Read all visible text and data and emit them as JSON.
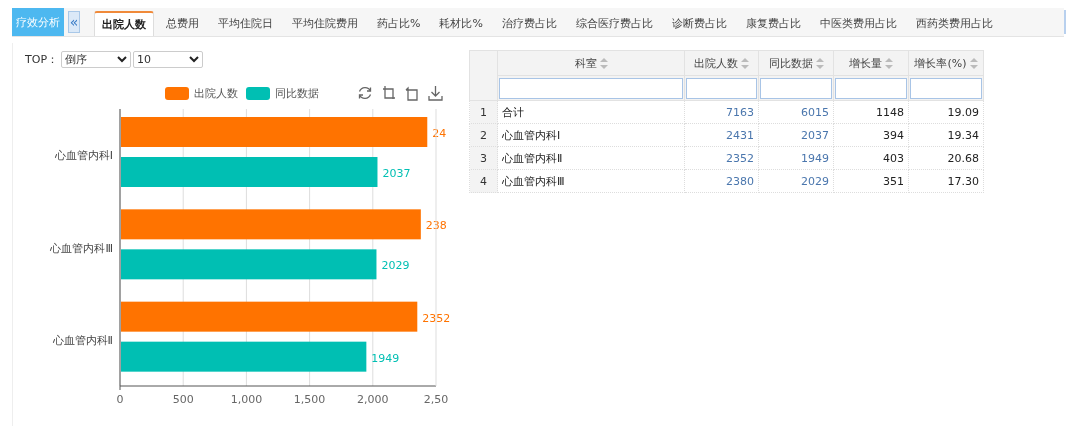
{
  "sidebar_button": {
    "label": "疗效分析"
  },
  "collapse_button": {
    "label": "«"
  },
  "tabs": [
    {
      "label": "出院人数",
      "selected": true
    },
    {
      "label": "总费用",
      "selected": false
    },
    {
      "label": "平均住院日",
      "selected": false
    },
    {
      "label": "平均住院费用",
      "selected": false
    },
    {
      "label": "药占比%",
      "selected": false
    },
    {
      "label": "耗材比%",
      "selected": false
    },
    {
      "label": "治疗费占比",
      "selected": false
    },
    {
      "label": "综合医疗费占比",
      "selected": false
    },
    {
      "label": "诊断费占比",
      "selected": false
    },
    {
      "label": "康复费占比",
      "selected": false
    },
    {
      "label": "中医类费用占比",
      "selected": false
    },
    {
      "label": "西药类费用占比",
      "selected": false
    }
  ],
  "top_filter": {
    "label": "TOP：",
    "order": "倒序",
    "count": "10"
  },
  "chart": {
    "bar_labels": [
      [
        "24",
        "238",
        "2352"
      ],
      [
        "2037",
        "2029",
        "1949"
      ]
    ],
    "cut_tick_label": "2,50",
    "chart_data": {
      "type": "bar",
      "orientation": "horizontal",
      "categories": [
        "心血管内科Ⅰ",
        "心血管内科Ⅲ",
        "心血管内科Ⅱ"
      ],
      "series": [
        {
          "name": "出院人数",
          "color": "#ff7300",
          "values": [
            2431,
            2380,
            2352
          ]
        },
        {
          "name": "同比数据",
          "color": "#00bfb3",
          "values": [
            2037,
            2029,
            1949
          ]
        }
      ],
      "grid": true,
      "xlim": [
        0,
        2500
      ],
      "xticks": [
        {
          "value": 0,
          "label": "0"
        },
        {
          "value": 500,
          "label": "500"
        },
        {
          "value": 1000,
          "label": "1,000"
        },
        {
          "value": 1500,
          "label": "1,500"
        },
        {
          "value": 2000,
          "label": "2,000"
        }
      ]
    }
  },
  "table": {
    "columns": [
      {
        "label": "科室",
        "kind": "text"
      },
      {
        "label": "出院人数",
        "kind": "link"
      },
      {
        "label": "同比数据",
        "kind": "link"
      },
      {
        "label": "增长量",
        "kind": "number"
      },
      {
        "label": "增长率(%)",
        "kind": "number"
      }
    ],
    "rows": [
      {
        "index": "1",
        "cells": [
          "合计",
          "7163",
          "6015",
          "1148",
          "19.09"
        ]
      },
      {
        "index": "2",
        "cells": [
          "心血管内科Ⅰ",
          "2431",
          "2037",
          "394",
          "19.34"
        ]
      },
      {
        "index": "3",
        "cells": [
          "心血管内科Ⅱ",
          "2352",
          "1949",
          "403",
          "20.68"
        ]
      },
      {
        "index": "4",
        "cells": [
          "心血管内科Ⅲ",
          "2380",
          "2029",
          "351",
          "17.30"
        ]
      }
    ]
  }
}
